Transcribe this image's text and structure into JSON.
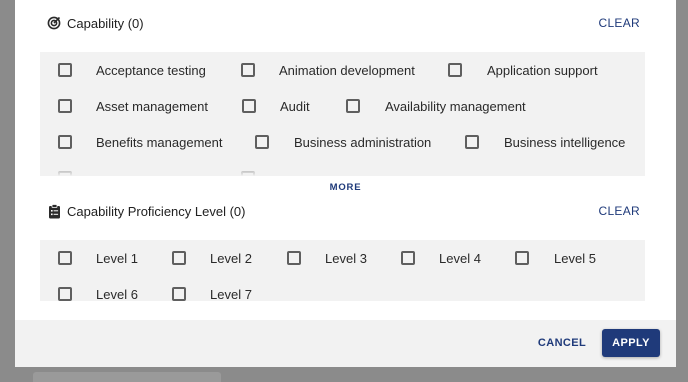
{
  "capability": {
    "title": "Capability (0)",
    "icon": "target-icon",
    "clear_label": "CLEAR",
    "more_label": "MORE",
    "rows": [
      [
        "Acceptance testing",
        "Animation development",
        "Application support"
      ],
      [
        "Asset management",
        "Audit",
        "Availability management"
      ],
      [
        "Benefits management",
        "Business administration",
        "Business intelligence"
      ]
    ]
  },
  "proficiency": {
    "title": "Capability Proficiency Level (0)",
    "icon": "clipboard-icon",
    "clear_label": "CLEAR",
    "rows": [
      [
        "Level 1",
        "Level 2",
        "Level 3",
        "Level 4",
        "Level 5"
      ],
      [
        "Level 6",
        "Level 7"
      ]
    ]
  },
  "footer": {
    "cancel_label": "CANCEL",
    "apply_label": "APPLY"
  },
  "colors": {
    "accent": "#1f3a7a",
    "panel": "#f2f2f2",
    "backdrop": "#8b8b8b"
  }
}
